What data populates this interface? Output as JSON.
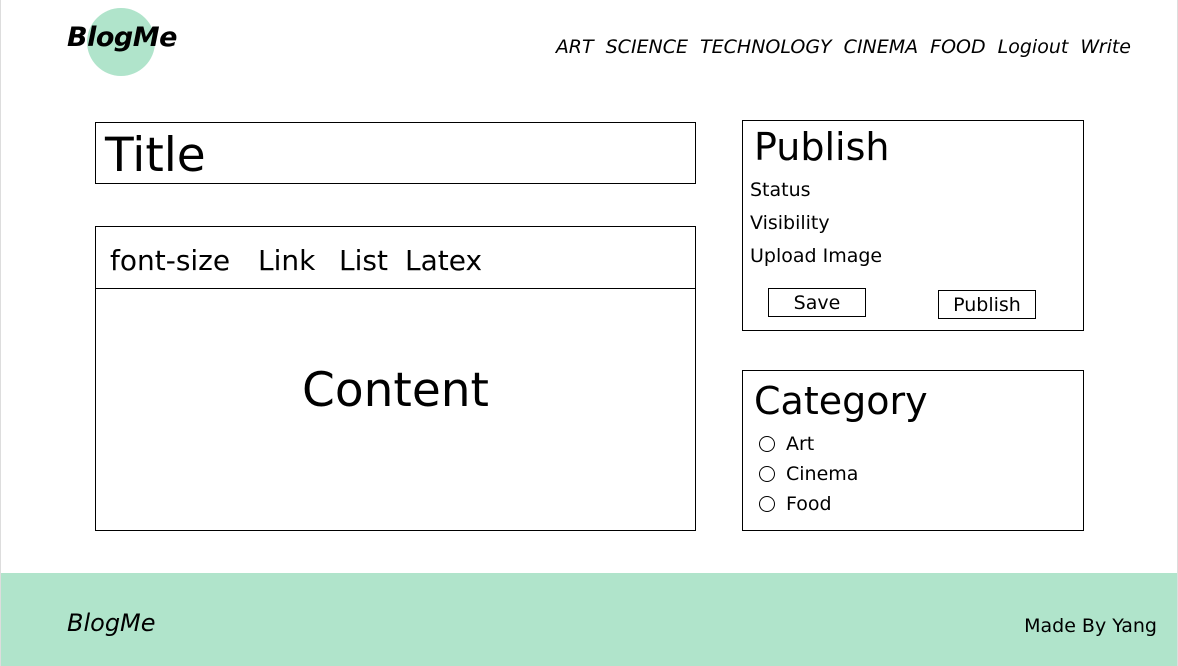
{
  "header": {
    "logo": "BlogMe",
    "nav": [
      "ART",
      "SCIENCE",
      "TECHNOLOGY",
      "CINEMA",
      "FOOD",
      "Logiout",
      "Write"
    ]
  },
  "editor": {
    "title_placeholder": "Title",
    "toolbar": [
      "font-size",
      "Link",
      "List",
      "Latex"
    ],
    "content_placeholder": "Content"
  },
  "publish": {
    "heading": "Publish",
    "status_label": "Status",
    "visibility_label": "Visibility",
    "upload_label": "Upload Image",
    "save_label": "Save",
    "publish_label": "Publish"
  },
  "category": {
    "heading": "Category",
    "options": [
      "Art",
      "Cinema",
      "Food"
    ]
  },
  "footer": {
    "logo": "BlogMe",
    "credit": "Made By Yang"
  },
  "colors": {
    "accent": "#b0e4cb"
  }
}
